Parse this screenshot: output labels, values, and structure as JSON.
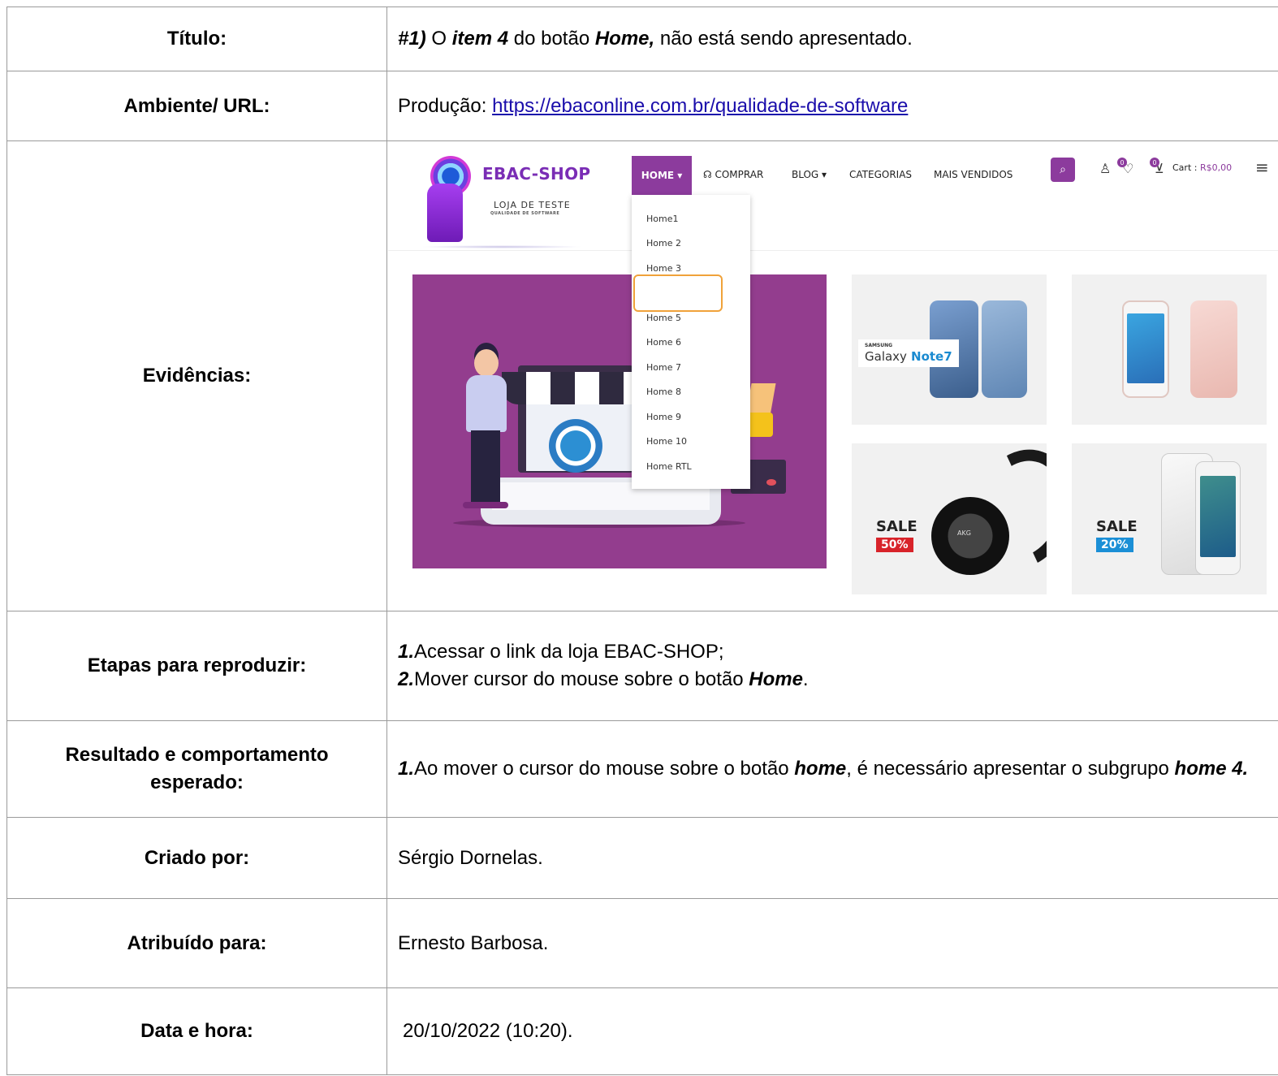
{
  "rows": {
    "titulo": {
      "label": "Título:",
      "parts": [
        "#1)",
        " O ",
        "item 4",
        " do botão ",
        "Home,",
        " não está sendo apresentado."
      ]
    },
    "ambiente": {
      "label": "Ambiente/ URL:",
      "prefix": "Produção: ",
      "url": "https://ebaconline.com.br/qualidade-de-software"
    },
    "evidencias": {
      "label": "Evidências:"
    },
    "etapas": {
      "label": "Etapas para reproduzir:",
      "step1_num": "1.",
      "step1_text": "Acessar o link da loja EBAC-SHOP;",
      "step2_num": "2.",
      "step2_text": "Mover cursor do mouse sobre o botão ",
      "step2_bold": "Home",
      "step2_end": "."
    },
    "resultado": {
      "label": "Resultado e comportamento esperado:",
      "num": "1.",
      "text_a": "Ao mover o cursor do mouse sobre o botão ",
      "bold_a": "home",
      "text_b": ", é necessário apresentar o subgrupo ",
      "bold_b": "home 4."
    },
    "criado": {
      "label": "Criado por:",
      "value": "Sérgio Dornelas."
    },
    "atribuido": {
      "label": "Atribuído para:",
      "value": "Ernesto Barbosa."
    },
    "data": {
      "label": "Data e hora:",
      "value": "20/10/2022 (10:20)."
    }
  },
  "shop": {
    "brand": "EBAC-SHOP",
    "tagline": "LOJA DE TESTE",
    "tagline_sub": "QUALIDADE DE SOFTWARE",
    "nav": {
      "home": "HOME ▾",
      "comprar": "COMPRAR",
      "blog": "BLOG ▾",
      "categorias": "CATEGORIAS",
      "mais_vendidos": "MAIS VENDIDOS"
    },
    "wishlist_count": "0",
    "cart_count": "0",
    "cart_label": "Cart :",
    "cart_value": "R$0,00",
    "dropdown": [
      "Home1",
      "Home 2",
      "Home 3",
      "Home 5",
      "Home 6",
      "Home 7",
      "Home 8",
      "Home 9",
      "Home 10",
      "Home RTL"
    ],
    "galaxy_brand": "SAMSUNG",
    "galaxy_name": "Galaxy",
    "galaxy_model": "Note7",
    "sale1_label": "SALE",
    "sale1_pct": "50%",
    "sale2_label": "SALE",
    "sale2_pct": "20%",
    "akg": "AKG"
  },
  "colors": {
    "brand": "#8c3b9d",
    "hero": "#933d8e",
    "link": "#1a0dab",
    "highlight": "#f0a23a",
    "sale1": "#d8232a",
    "sale2": "#1b8fd6"
  }
}
